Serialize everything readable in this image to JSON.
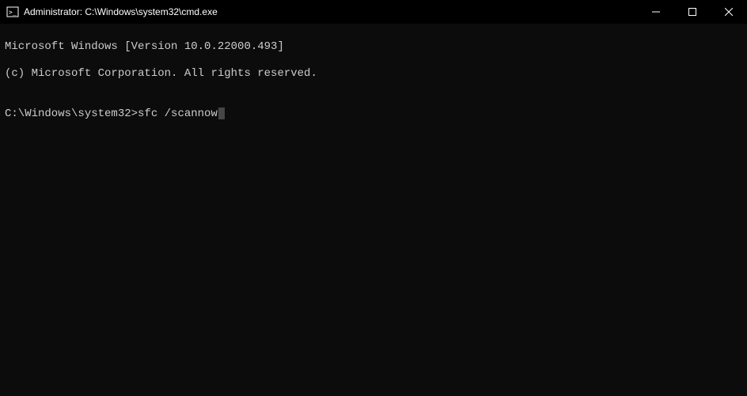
{
  "titlebar": {
    "title": "Administrator: C:\\Windows\\system32\\cmd.exe"
  },
  "terminal": {
    "line1": "Microsoft Windows [Version 10.0.22000.493]",
    "line2": "(c) Microsoft Corporation. All rights reserved.",
    "blank": "",
    "prompt": "C:\\Windows\\system32>",
    "command": "sfc /scannow"
  }
}
